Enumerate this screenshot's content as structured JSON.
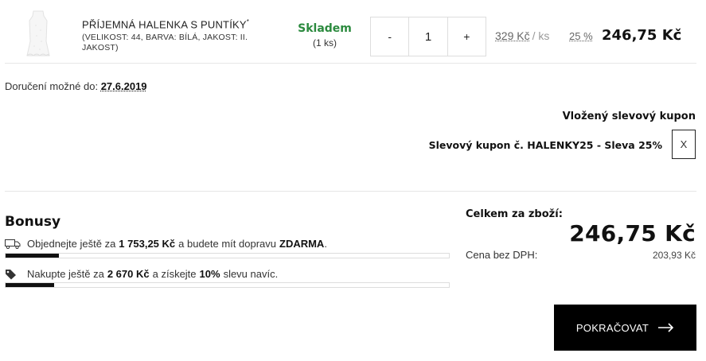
{
  "product": {
    "name": "PŘÍJEMNÁ HALENKA S PUNTÍKY",
    "name_mark": "*",
    "description": "(VELIKOST: 44, BARVA: BÍLÁ, JAKOST: II. JAKOST)",
    "stock_status": "Skladem",
    "stock_count": "(1 ks)",
    "quantity": "1",
    "decrement_label": "-",
    "increment_label": "+",
    "old_price": "329 Kč",
    "old_price_unit": "/ ks",
    "discount": "25 %",
    "price": "246,75 Kč"
  },
  "delivery": {
    "label": "Doručení možné do:",
    "date": "27.6.2019"
  },
  "coupon": {
    "title": "Vložený slevový kupon",
    "line": "Slevový kupon č. HALENKY25 - Sleva 25%",
    "remove_label": "X"
  },
  "bonuses": {
    "title": "Bonusy",
    "items": [
      {
        "icon": "truck-icon",
        "text_before": "Objednejte ještě za",
        "amount": "1 753,25 Kč",
        "text_middle": "a budete mít dopravu",
        "reward": "ZDARMA",
        "text_after": ".",
        "progress": 0.12
      },
      {
        "icon": "tag-icon",
        "text_before": "Nakupte ještě za",
        "amount": "2 670 Kč",
        "text_middle": "a získejte",
        "reward": "10%",
        "text_after": "slevu navíc.",
        "progress": 0.11
      }
    ]
  },
  "totals": {
    "label": "Celkem za zboží:",
    "price": "246,75 Kč",
    "no_vat_label": "Cena bez DPH:",
    "no_vat_price": "203,93 Kč"
  },
  "actions": {
    "continue_label": "POKRAČOVAT"
  },
  "colors": {
    "stock_green": "#2b8a3e",
    "button_bg": "#000000",
    "progress_fill": "#111111"
  }
}
